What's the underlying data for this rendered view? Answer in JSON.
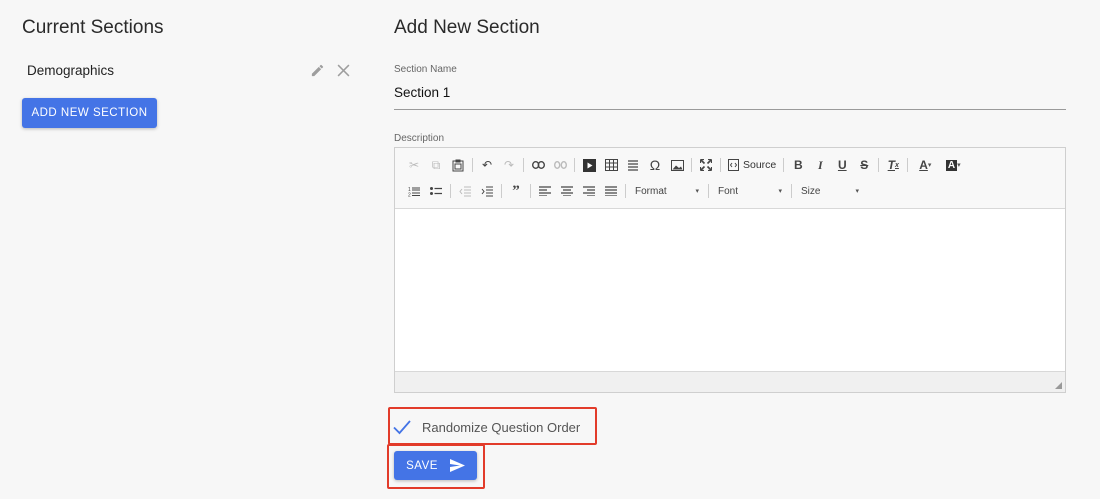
{
  "left": {
    "title": "Current Sections",
    "sections": [
      {
        "name": "Demographics"
      }
    ],
    "add_button": "ADD NEW SECTION"
  },
  "right": {
    "title": "Add New Section",
    "section_name_label": "Section Name",
    "section_name_value": "Section 1",
    "description_label": "Description",
    "toolbar": {
      "source_label": "Source",
      "format_label": "Format",
      "font_label": "Font",
      "size_label": "Size"
    },
    "randomize_label": "Randomize Question Order",
    "randomize_checked": true,
    "save_label": "SAVE"
  },
  "colors": {
    "accent": "#4474e6",
    "highlight": "#e23b2a"
  }
}
